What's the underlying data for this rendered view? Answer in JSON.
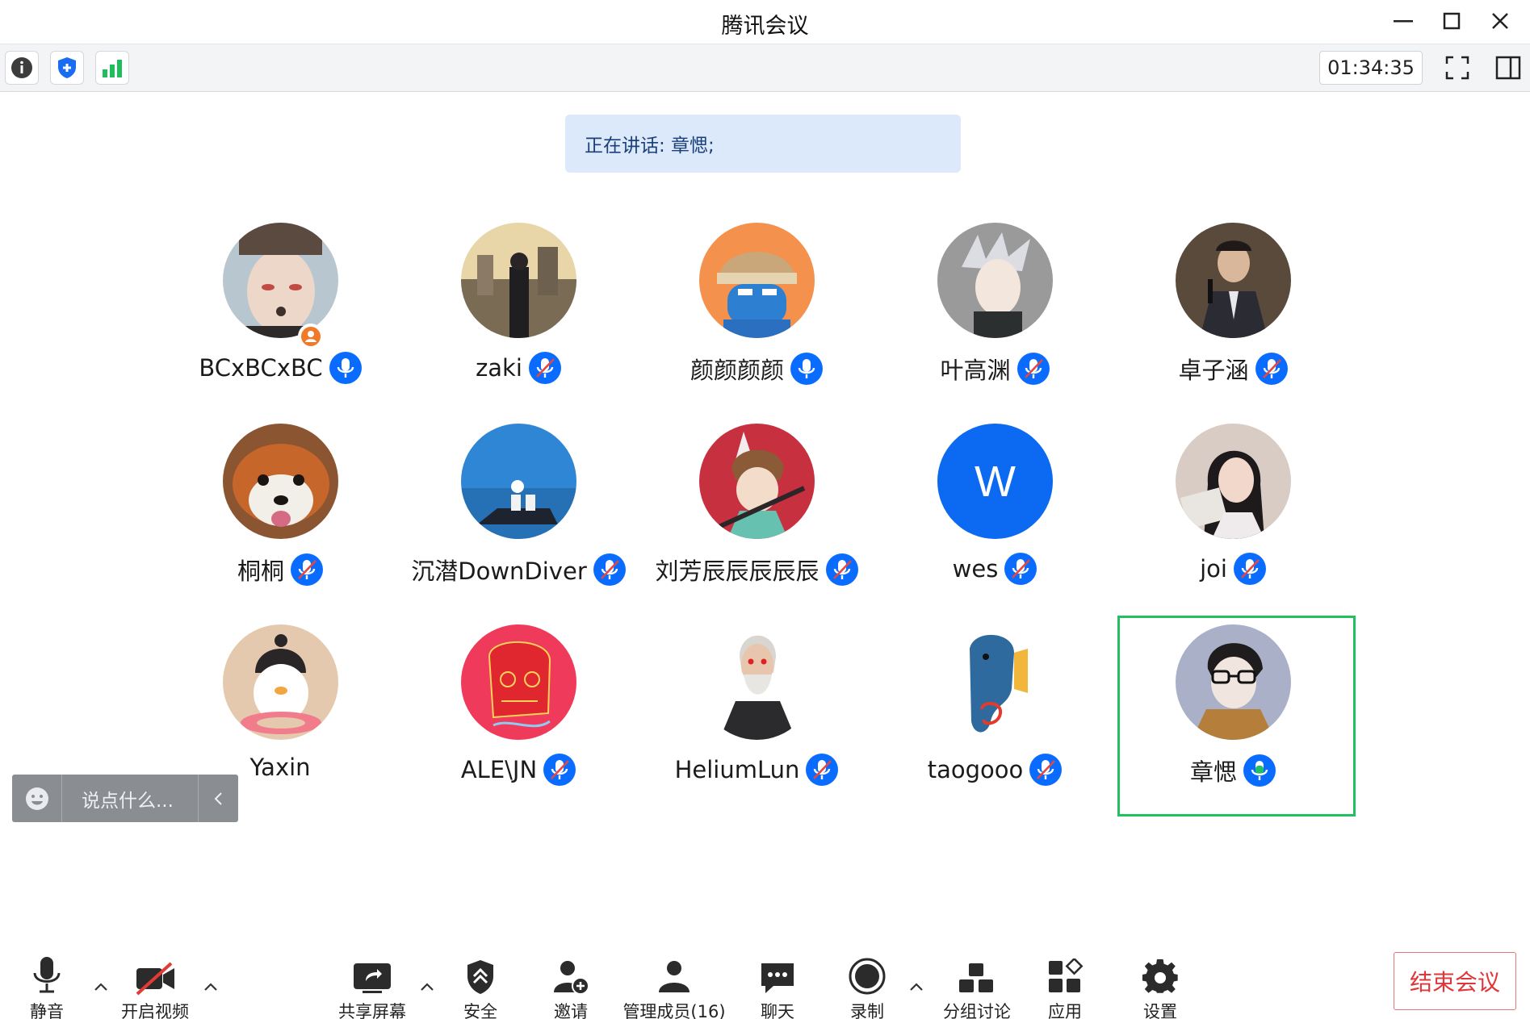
{
  "window": {
    "title": "腾讯会议"
  },
  "toolbar": {
    "timer": "01:34:35"
  },
  "speaking": {
    "text": "正在讲话: 章愢;"
  },
  "participants": [
    {
      "name": "BCxBCxBC",
      "mic": "on",
      "host": true,
      "avatar": "photo-man"
    },
    {
      "name": "zaki",
      "mic": "muted",
      "avatar": "photo-city"
    },
    {
      "name": "颜颜颜颜",
      "mic": "on",
      "avatar": "cartoon-viking"
    },
    {
      "name": "叶高渊",
      "mic": "muted",
      "avatar": "anime-silver-hair"
    },
    {
      "name": "卓子涵",
      "mic": "muted",
      "avatar": "photo-speaker"
    },
    {
      "name": "桐桐",
      "mic": "muted",
      "avatar": "photo-red-panda"
    },
    {
      "name": "沉潜DownDiver",
      "mic": "muted",
      "avatar": "illustration-astronauts"
    },
    {
      "name": "刘芳辰辰辰辰辰",
      "mic": "muted",
      "avatar": "anime-horned-boy"
    },
    {
      "name": "wes",
      "mic": "muted",
      "avatar": "letter",
      "initial": "W"
    },
    {
      "name": "joi",
      "mic": "muted",
      "avatar": "photo-girl"
    },
    {
      "name": "Yaxin",
      "mic": "none",
      "avatar": "cartoon-penguin"
    },
    {
      "name": "ALE\\JN",
      "mic": "muted",
      "avatar": "art-red-skull"
    },
    {
      "name": "HeliumLun",
      "mic": "muted",
      "avatar": "render-old-man"
    },
    {
      "name": "taogooo",
      "mic": "muted",
      "avatar": "cartoon-elephant"
    },
    {
      "name": "章愢",
      "mic": "speaking",
      "avatar": "cartoon-glasses-man",
      "active": true
    }
  ],
  "chat": {
    "placeholder": "说点什么..."
  },
  "bottom_bar": {
    "mute": "静音",
    "video": "开启视频",
    "share": "共享屏幕",
    "security": "安全",
    "invite": "邀请",
    "members": "管理成员(16)",
    "chat": "聊天",
    "record": "录制",
    "breakout": "分组讨论",
    "apps": "应用",
    "settings": "设置",
    "end": "结束会议"
  },
  "colors": {
    "accent": "#0a6cff",
    "speaking_green": "#21c162",
    "end_red": "#e0363a",
    "muted_slash": "#e4473f"
  }
}
